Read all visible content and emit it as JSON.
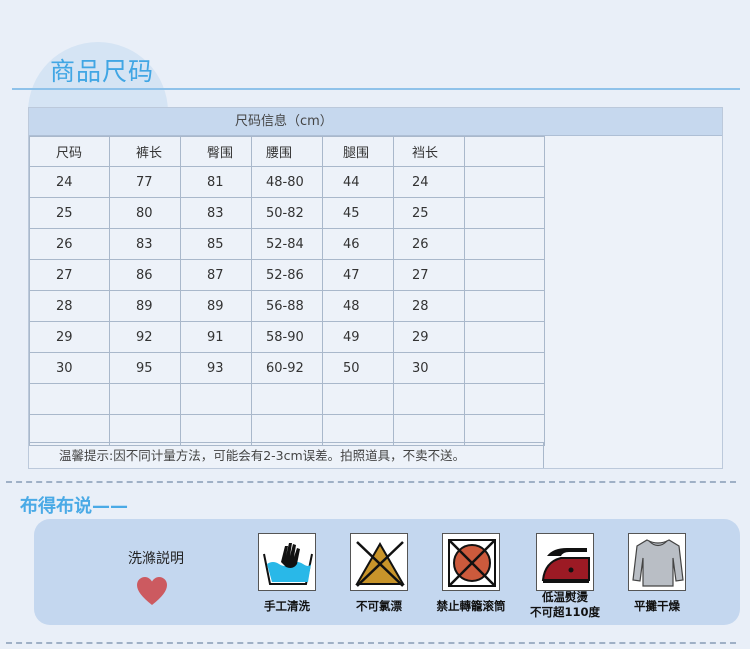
{
  "section1": {
    "title": "商品尺码"
  },
  "size_table": {
    "caption": "尺码信息（cm）",
    "headers": [
      "尺码",
      "裤长",
      "臀围",
      "腰围",
      "腿围",
      "裆长",
      ""
    ],
    "rows": [
      [
        "24",
        "77",
        "81",
        "48-80",
        "44",
        "24",
        ""
      ],
      [
        "25",
        "80",
        "83",
        "50-82",
        "45",
        "25",
        ""
      ],
      [
        "26",
        "83",
        "85",
        "52-84",
        "46",
        "26",
        ""
      ],
      [
        "27",
        "86",
        "87",
        "52-86",
        "47",
        "27",
        ""
      ],
      [
        "28",
        "89",
        "89",
        "56-88",
        "48",
        "28",
        ""
      ],
      [
        "29",
        "92",
        "91",
        "58-90",
        "49",
        "29",
        ""
      ],
      [
        "30",
        "95",
        "93",
        "60-92",
        "50",
        "30",
        ""
      ],
      [
        "",
        "",
        "",
        "",
        "",
        "",
        ""
      ],
      [
        "",
        "",
        "",
        "",
        "",
        "",
        ""
      ]
    ],
    "tip": "温馨提示:因不同计量方法，可能会有2-3cm误差。拍照道具，不卖不送。"
  },
  "section2": {
    "title": "布得布说——",
    "care_label": "洗滌説明",
    "icons": [
      {
        "icon": "hand-wash-icon",
        "caption_lines": [
          "手工清洗"
        ]
      },
      {
        "icon": "no-bleach-icon",
        "caption_lines": [
          "不可氯漂"
        ]
      },
      {
        "icon": "no-tumble-dry-icon",
        "caption_lines": [
          "禁止轉籠滚筒"
        ]
      },
      {
        "icon": "iron-low-icon",
        "caption_lines": [
          "低温熨燙",
          "不可超110度"
        ]
      },
      {
        "icon": "dry-flat-icon",
        "caption_lines": [
          "平攤干燥"
        ]
      }
    ]
  },
  "colors": {
    "accent": "#41a6e4",
    "panel": "#c4d7ef",
    "heart": "#cc5a60"
  }
}
